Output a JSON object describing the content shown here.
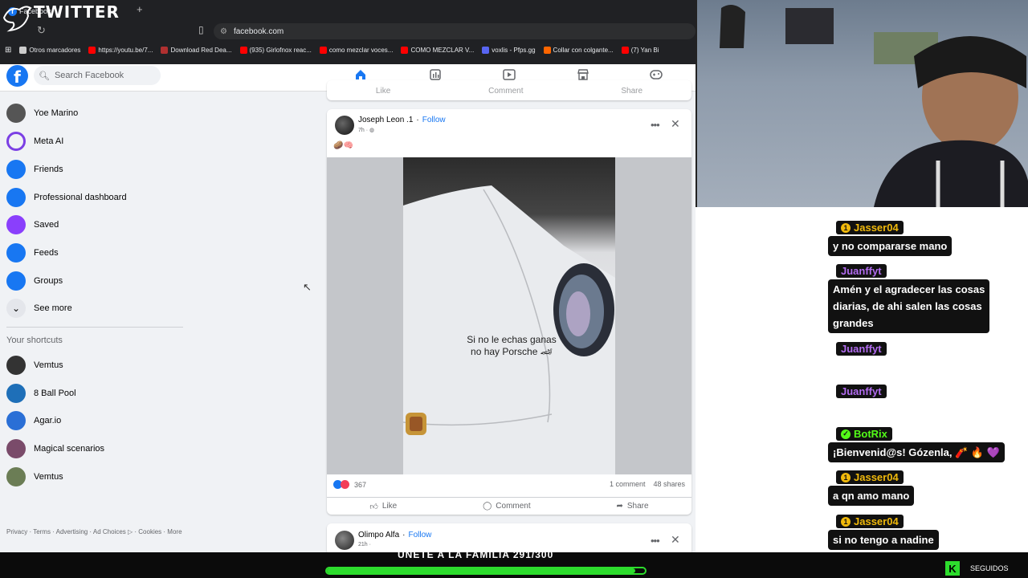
{
  "browser": {
    "tab_title": "Facebook",
    "overlay_logo": "TWITTER",
    "url": "facebook.com",
    "bookmarks": [
      {
        "label": "Otros marcadores",
        "color": "#cccccc"
      },
      {
        "label": "https://youtu.be/7...",
        "color": "#ff0000"
      },
      {
        "label": "Download Red Dea...",
        "color": "#b03030"
      },
      {
        "label": "(935) Girlofnox reac...",
        "color": "#ff0000"
      },
      {
        "label": "como mezclar voces...",
        "color": "#ff0000"
      },
      {
        "label": "COMO MEZCLAR V...",
        "color": "#ff0000"
      },
      {
        "label": "voxlis - Pfps.gg",
        "color": "#5865f2"
      },
      {
        "label": "Collar con colgante...",
        "color": "#ff6600"
      },
      {
        "label": "(7) Yan Bi",
        "color": "#ff0000"
      }
    ]
  },
  "fb": {
    "search_placeholder": "Search Facebook",
    "brand_color": "#1877f2",
    "sidebar": [
      {
        "label": "Yoe Marino",
        "icon": "profile-avatar",
        "color": "#555555"
      },
      {
        "label": "Meta AI",
        "icon": "meta-ai-icon",
        "color": "#7b3fe4"
      },
      {
        "label": "Friends",
        "icon": "friends-icon",
        "color": "#1877f2"
      },
      {
        "label": "Professional dashboard",
        "icon": "dashboard-icon",
        "color": "#1877f2"
      },
      {
        "label": "Saved",
        "icon": "bookmark-icon",
        "color": "#8a3ffc"
      },
      {
        "label": "Feeds",
        "icon": "feeds-icon",
        "color": "#1877f2"
      },
      {
        "label": "Groups",
        "icon": "groups-icon",
        "color": "#1877f2"
      },
      {
        "label": "See more",
        "icon": "chevron-down-icon",
        "color": "#e4e6eb"
      }
    ],
    "shortcuts_heading": "Your shortcuts",
    "shortcuts": [
      {
        "label": "Vemtus",
        "color": "#333333"
      },
      {
        "label": "8 Ball Pool",
        "color": "#1e6fb8"
      },
      {
        "label": "Agar.io",
        "color": "#2a6fd6"
      },
      {
        "label": "Magical scenarios",
        "color": "#7a4b6a"
      },
      {
        "label": "Vemtus",
        "color": "#6b7d55"
      }
    ],
    "footer": "Privacy · Terms · Advertising · Ad Choices ▷ · Cookies · More",
    "prev_actions": [
      "Like",
      "Comment",
      "Share"
    ],
    "post": {
      "author": "Joseph Leon .1",
      "follow": "Follow",
      "time": "7h ·",
      "caption": "🥔🧠",
      "overlay_text_1": "Si no le echas ganas",
      "overlay_text_2": "no hay Porsche 🏎",
      "reactions": "367",
      "comments": "1 comment",
      "shares": "48 shares",
      "like": "Like",
      "comment": "Comment",
      "share": "Share"
    },
    "post2": {
      "author": "Olimpo Alfa",
      "follow": "Follow",
      "time": "21h ·"
    }
  },
  "chat": [
    {
      "user": "Jasser04",
      "user_color": "#f0b90b",
      "messages": [
        "y no compararse mano"
      ]
    },
    {
      "user": "Juanffyt",
      "user_color": "#b26cf0",
      "messages": [
        "Amén y el agradecer las cosas",
        "diarias, de ahi salen las cosas",
        "grandes"
      ]
    },
    {
      "user": "Juanffyt",
      "user_color": "#b26cf0",
      "messages": []
    },
    {
      "user": "Juanffyt",
      "user_color": "#b26cf0",
      "messages": []
    },
    {
      "user": "BotRix",
      "user_color": "#53fc18",
      "messages": [
        "¡Bienvenid@s! Gózenla, 🧨 🔥 💜"
      ]
    },
    {
      "user": "Jasser04",
      "user_color": "#f0b90b",
      "messages": [
        "a qn amo mano"
      ]
    },
    {
      "user": "Jasser04",
      "user_color": "#f0b90b",
      "messages": [
        "si no tengo a nadine"
      ]
    }
  ],
  "stream_bar": {
    "promo": "UNETE A LA FAMILIA 291/300",
    "progress": 0.97,
    "accent": "#2ddc2d",
    "k_badge": "K",
    "follow_label": "SEGUIDOS"
  }
}
